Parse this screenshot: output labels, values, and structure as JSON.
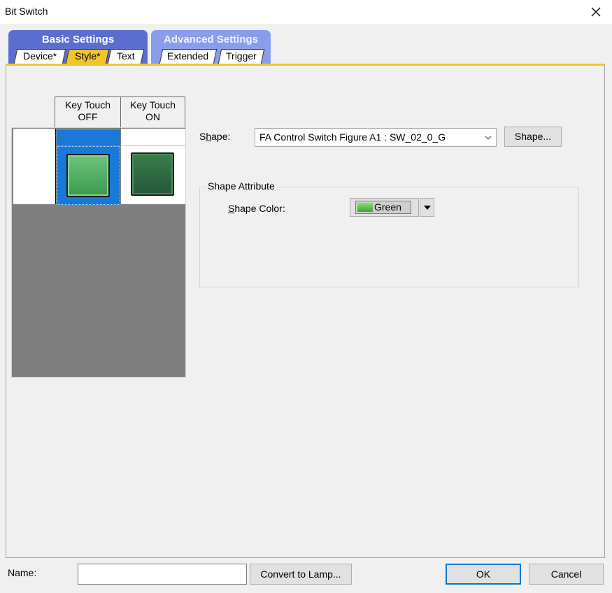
{
  "window": {
    "title": "Bit Switch"
  },
  "tabs": {
    "basic_group": "Basic Settings",
    "advanced_group": "Advanced Settings",
    "device": "Device*",
    "style": "Style*",
    "text": "Text",
    "extended": "Extended",
    "trigger": "Trigger"
  },
  "preview": {
    "col_off_line1": "Key Touch",
    "col_off_line2": "OFF",
    "col_on_line1": "Key Touch",
    "col_on_line2": "ON"
  },
  "shape": {
    "label": "Shape:",
    "value": "FA Control Switch Figure A1 : SW_02_0_G",
    "button": "Shape..."
  },
  "shape_attribute": {
    "group_title": "Shape Attribute",
    "color_label": "Shape Color:",
    "color_value": "Green",
    "color_hex": "#4cbb3a"
  },
  "footer": {
    "name_label": "Name:",
    "name_value": "",
    "convert_button": "Convert to Lamp...",
    "ok_button": "OK",
    "cancel_button": "Cancel"
  }
}
